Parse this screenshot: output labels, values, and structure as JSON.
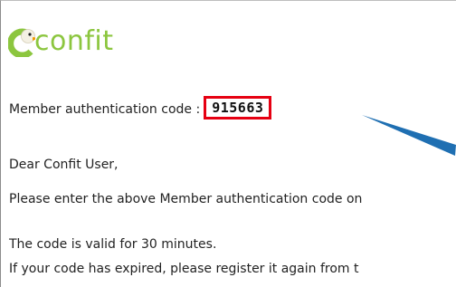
{
  "logo": {
    "text": "confit",
    "icon": "duck-c-logo-icon",
    "color": "#8cc63f"
  },
  "auth": {
    "label": "Member authentication code :",
    "code": "915663",
    "highlight_color": "#e60012"
  },
  "greeting": "Dear Confit User,",
  "instruction": "Please enter the above Member authentication code on",
  "validity": "The code is valid for 30 minutes.",
  "expired_note": "If your code has expired, please register it again from t",
  "annotation": {
    "icon": "pointer-arrow-icon",
    "color": "#1f6fb2"
  }
}
